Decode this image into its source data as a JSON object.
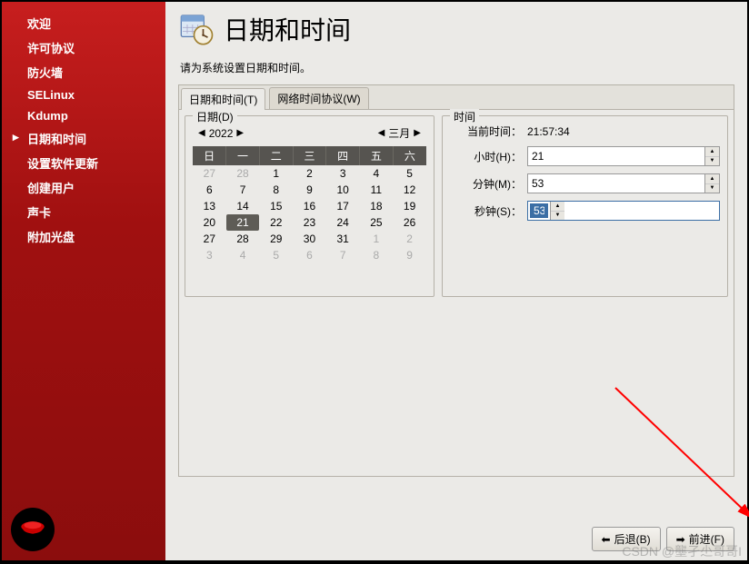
{
  "sidebar": {
    "items": [
      {
        "label": "欢迎"
      },
      {
        "label": "许可协议"
      },
      {
        "label": "防火墙"
      },
      {
        "label": "SELinux"
      },
      {
        "label": "Kdump"
      },
      {
        "label": "日期和时间"
      },
      {
        "label": "设置软件更新"
      },
      {
        "label": "创建用户"
      },
      {
        "label": "声卡"
      },
      {
        "label": "附加光盘"
      }
    ],
    "active_index": 5
  },
  "header": {
    "title": "日期和时间",
    "subtitle": "请为系统设置日期和时间。"
  },
  "tabs": {
    "items": [
      {
        "label": "日期和时间(T)"
      },
      {
        "label": "网络时间协议(W)"
      }
    ],
    "active_index": 0
  },
  "date_group": {
    "title": "日期(D)",
    "year": "2022",
    "month": "三月",
    "weekdays": [
      "日",
      "一",
      "二",
      "三",
      "四",
      "五",
      "六"
    ],
    "weeks": [
      [
        {
          "d": "27",
          "o": true
        },
        {
          "d": "28",
          "o": true
        },
        {
          "d": "1"
        },
        {
          "d": "2"
        },
        {
          "d": "3"
        },
        {
          "d": "4"
        },
        {
          "d": "5"
        }
      ],
      [
        {
          "d": "6"
        },
        {
          "d": "7"
        },
        {
          "d": "8"
        },
        {
          "d": "9"
        },
        {
          "d": "10"
        },
        {
          "d": "11"
        },
        {
          "d": "12"
        }
      ],
      [
        {
          "d": "13"
        },
        {
          "d": "14"
        },
        {
          "d": "15"
        },
        {
          "d": "16"
        },
        {
          "d": "17"
        },
        {
          "d": "18"
        },
        {
          "d": "19"
        }
      ],
      [
        {
          "d": "20"
        },
        {
          "d": "21",
          "sel": true
        },
        {
          "d": "22"
        },
        {
          "d": "23"
        },
        {
          "d": "24"
        },
        {
          "d": "25"
        },
        {
          "d": "26"
        }
      ],
      [
        {
          "d": "27"
        },
        {
          "d": "28"
        },
        {
          "d": "29"
        },
        {
          "d": "30"
        },
        {
          "d": "31"
        },
        {
          "d": "1",
          "o": true
        },
        {
          "d": "2",
          "o": true
        }
      ],
      [
        {
          "d": "3",
          "o": true
        },
        {
          "d": "4",
          "o": true
        },
        {
          "d": "5",
          "o": true
        },
        {
          "d": "6",
          "o": true
        },
        {
          "d": "7",
          "o": true
        },
        {
          "d": "8",
          "o": true
        },
        {
          "d": "9",
          "o": true
        }
      ]
    ]
  },
  "time_group": {
    "title": "时间",
    "current_label": "当前时间：",
    "current_value": "21:57:34",
    "hour_label": "小时(H)：",
    "hour_value": "21",
    "minute_label": "分钟(M)：",
    "minute_value": "53",
    "second_label": "秒钟(S)：",
    "second_value": "53"
  },
  "footer": {
    "back_label": "后退(B)",
    "forward_label": "前进(F)"
  },
  "watermark": "CSDN @壟孑尐哥哥I"
}
